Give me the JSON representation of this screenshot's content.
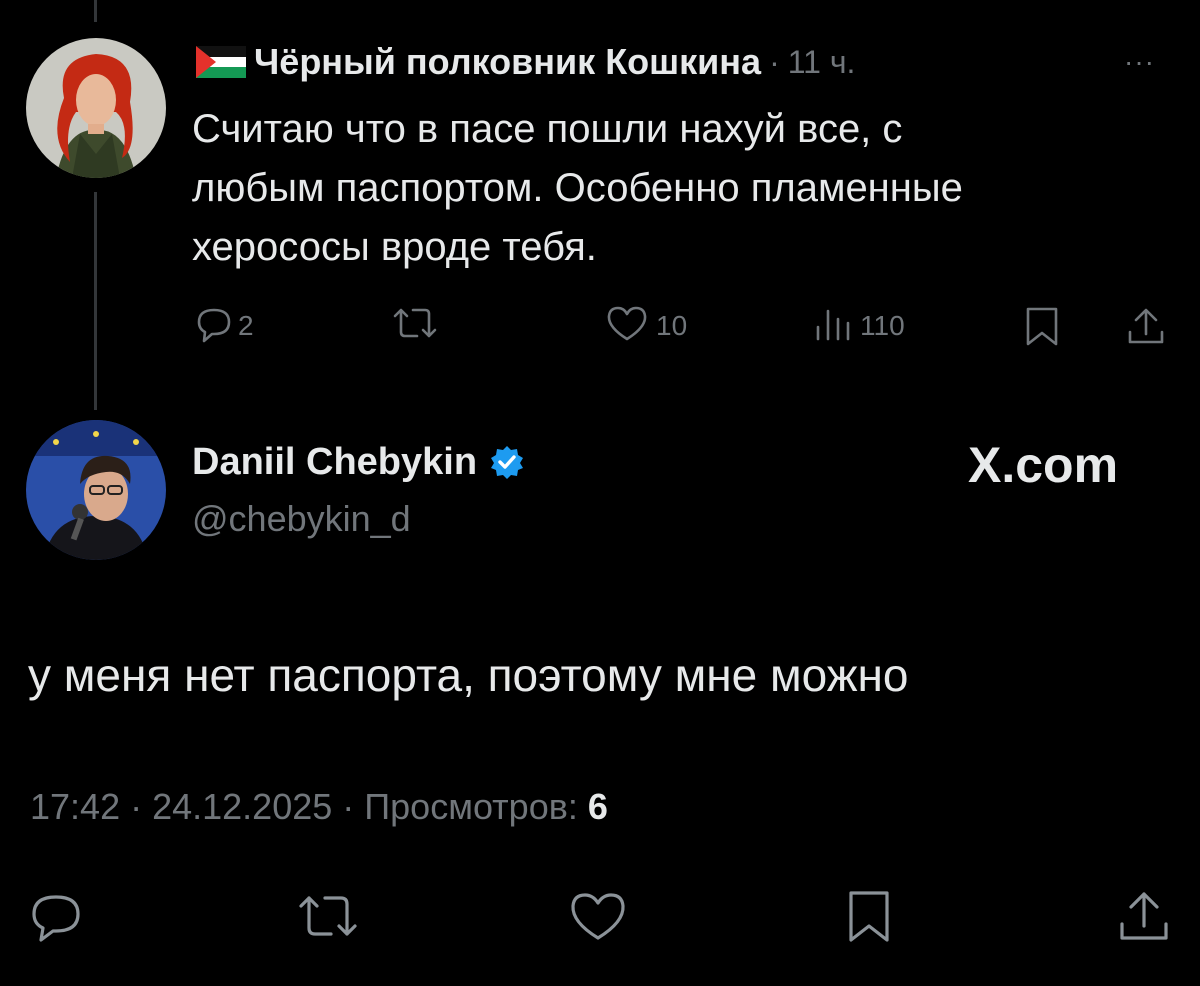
{
  "reply_tweet": {
    "author_name": "Чёрный полковник Кошкина",
    "separator": "·",
    "time": "11 ч.",
    "more_label": "···",
    "text_lines": [
      "Считаю что в пасе пошли нахуй все, с",
      "любым паспортом. Особенно пламенные",
      "херососы вроде тебя."
    ],
    "actions": {
      "replies": "2",
      "retweets": "",
      "likes": "10",
      "views": "110"
    },
    "flag_icon": "palestine-flag-icon"
  },
  "main_tweet": {
    "author_name": "Daniil Chebykin",
    "handle": "@chebykin_d",
    "verified": true,
    "brand": "X.com",
    "text": "у меня нет паспорта, поэтому мне можно",
    "meta": {
      "time": "17:42",
      "separator": "·",
      "date": "24.12.2025",
      "views_label": "Просмотров:",
      "views_count": "6"
    }
  },
  "colors": {
    "background": "#000000",
    "text": "#e7e9ea",
    "secondary": "#71767b",
    "verified": "#1d9bf0",
    "thread_line": "#333639"
  }
}
